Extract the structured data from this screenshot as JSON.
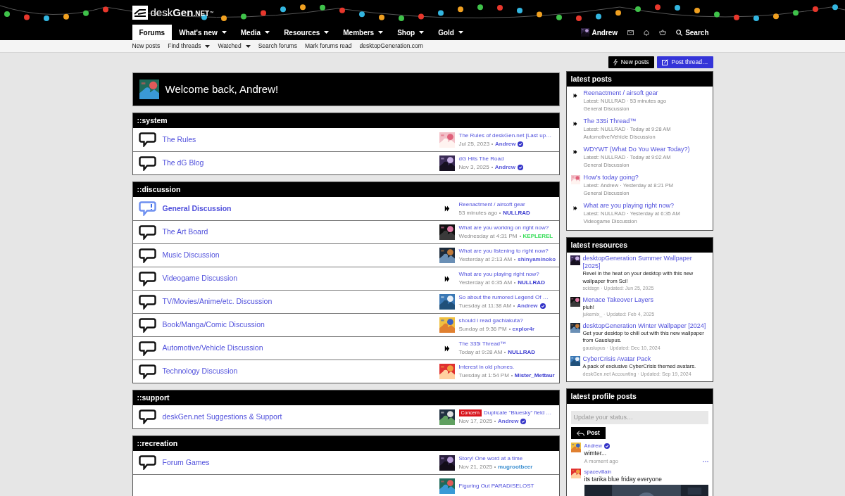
{
  "logo": {
    "name": "desk",
    "bold": "Gen",
    "suffix": ".NET",
    "mark": "™"
  },
  "nav": [
    {
      "label": "Forums",
      "selected": true,
      "dropdown": false
    },
    {
      "label": "What's new",
      "selected": false,
      "dropdown": true
    },
    {
      "label": "Media",
      "selected": false,
      "dropdown": true
    },
    {
      "label": "Resources",
      "selected": false,
      "dropdown": true
    },
    {
      "label": "Members",
      "selected": false,
      "dropdown": true
    },
    {
      "label": "Shop",
      "selected": false,
      "dropdown": true
    },
    {
      "label": "Gold",
      "selected": false,
      "dropdown": true
    }
  ],
  "user": {
    "name": "Andrew"
  },
  "header_search": "Search",
  "subnav": [
    {
      "label": "New posts",
      "dropdown": false
    },
    {
      "label": "Find threads",
      "dropdown": true
    },
    {
      "label": "Watched",
      "dropdown": true
    },
    {
      "label": "Search forums",
      "dropdown": false
    },
    {
      "label": "Mark forums read",
      "dropdown": false
    },
    {
      "label": "desktopGeneration.com",
      "dropdown": false
    }
  ],
  "actions": [
    {
      "kind": "new",
      "label": "New posts"
    },
    {
      "kind": "post",
      "label": "Post thread…"
    }
  ],
  "welcome": "Welcome back, Andrew!",
  "sections": [
    {
      "title": "::system",
      "forums": [
        {
          "name": "The Rules",
          "unread": false,
          "last_post": {
            "title": "The Rules of deskGen.net [Last up…",
            "time": "Jul 25, 2023",
            "author": "Andrew",
            "verified": true,
            "color": "#5c5cdb"
          }
        },
        {
          "name": "The dG Blog",
          "unread": false,
          "last_post": {
            "title": "dG Hits The Road",
            "time": "Nov 3, 2025",
            "author": "Andrew",
            "verified": true,
            "color": "#5c5cdb"
          }
        }
      ]
    },
    {
      "title": "::discussion",
      "forums": [
        {
          "name": "General Discussion",
          "unread": true,
          "last_post": {
            "avatar": {
              "kind": "logo"
            },
            "title": "Reenactment / airsoft gear",
            "time": "53 minutes ago",
            "author": "NULLRAD",
            "verified": false,
            "color": "#3b3bd0"
          }
        },
        {
          "name": "The Art Board",
          "unread": false,
          "last_post": {
            "title": "What are you working on right now?",
            "time": "Wednesday at 4:31 PM",
            "author": "KEPLEREL",
            "verified": false,
            "color": "#33dd55"
          }
        },
        {
          "name": "Music Discussion",
          "unread": false,
          "last_post": {
            "title": "What are you listening to right now?",
            "time": "Yesterday at 2:13 AM",
            "author": "shinyaminoko",
            "verified": false,
            "color": "#5c5cdb"
          }
        },
        {
          "name": "Videogame Discussion",
          "unread": false,
          "last_post": {
            "avatar": {
              "kind": "logo"
            },
            "title": "What are you playing right now?",
            "time": "Yesterday at 6:35 AM",
            "author": "NULLRAD",
            "verified": false,
            "color": "#3b3bd0"
          }
        },
        {
          "name": "TV/Movies/Anime/etc. Discussion",
          "unread": false,
          "last_post": {
            "title": "So about the rumored Legend Of …",
            "time": "Tuesday at 11:38 AM",
            "author": "Andrew",
            "verified": true,
            "color": "#5c5cdb"
          }
        },
        {
          "name": "Book/Manga/Comic Discussion",
          "unread": false,
          "last_post": {
            "title": "should i read gachiakuta?",
            "time": "Sunday at 9:36 PM",
            "author": "explor4r",
            "verified": false,
            "color": "#5c5cdb"
          }
        },
        {
          "name": "Automotive/Vehicle Discussion",
          "unread": false,
          "last_post": {
            "avatar": {
              "kind": "logo"
            },
            "title": "The 335i Thread™",
            "time": "Today at 9:28 AM",
            "author": "NULLRAD",
            "verified": false,
            "color": "#3b3bd0"
          }
        },
        {
          "name": "Technology Discussion",
          "unread": false,
          "last_post": {
            "title": "Interest in old phones.",
            "time": "Tuesday at 1:54 PM",
            "author": "Mister_Mettaur",
            "verified": false,
            "color": "#3b3bd0"
          }
        }
      ]
    },
    {
      "title": "::support",
      "forums": [
        {
          "name": "deskGen.net Suggestions & Support",
          "unread": false,
          "last_post": {
            "prefix": "Concern",
            "title": "Duplicate \"Bluesky\" field …",
            "time": "Nov 17, 2025",
            "author": "Andrew",
            "verified": true,
            "color": "#5c5cdb"
          }
        }
      ]
    },
    {
      "title": "::recreation",
      "forums": [
        {
          "name": "Forum Games",
          "unread": false,
          "last_post": {
            "title": "Story! One word at a time",
            "time": "Nov 21, 2025",
            "author": "mugrootbeer",
            "verified": false,
            "color": "#3b8fd0"
          }
        },
        {
          "last_post": {
            "title": "Figuring Out PARADISELOST"
          }
        }
      ]
    }
  ],
  "latest_posts": {
    "title": "latest posts",
    "items": [
      {
        "avatar": {
          "kind": "logo"
        },
        "title": "Reenactment / airsoft gear",
        "meta": "Latest: NULLRAD · 53 minutes ago",
        "forum": "General Discussion"
      },
      {
        "avatar": {
          "kind": "logo"
        },
        "title": "The 335i Thread™",
        "meta": "Latest: NULLRAD · Today at 9:28 AM",
        "forum": "Automotive/Vehicle Discussion"
      },
      {
        "avatar": {
          "kind": "logo"
        },
        "title": "WDYWT (What Do You Wear Today?)",
        "meta": "Latest: NULLRAD · Today at 9:02 AM",
        "forum": "General Discussion"
      },
      {
        "title": "How's today going?",
        "meta": "Latest: Andrew · Yesterday at 8:21 PM",
        "forum": "General Discussion"
      },
      {
        "avatar": {
          "kind": "logo"
        },
        "title": "What are you playing right now?",
        "meta": "Latest: NULLRAD · Yesterday at 6:35 AM",
        "forum": "Videogame Discussion"
      }
    ]
  },
  "latest_resources": {
    "title": "latest resources",
    "items": [
      {
        "title": "desktopGeneration Summer Wallpaper [2025]",
        "description": "Revel in the heat on your desktop with this new wallpaper from Sci!",
        "meta": "scidsgn · Updated: Jun 25, 2025"
      },
      {
        "title": "Menace Takeover Layers",
        "description": "pluh!",
        "meta": "jukemix_ · Updated: Feb 4, 2025"
      },
      {
        "title": "desktopGeneration Winter Wallpaper [2024]",
        "description": "Get your desktop to chill out with this new wallpaper from Gauslupus.",
        "meta": "gauslupus · Updated: Dec 10, 2024"
      },
      {
        "title": "CyberCrisis Avatar Pack",
        "description": "A pack of exclusive CyberCrisis themed avatars.",
        "meta": "deskGen.net Accounting · Updated: Sep 19, 2024"
      }
    ]
  },
  "profile_posts": {
    "title": "latest profile posts",
    "placeholder": "Update your status…",
    "button": "Post",
    "posts": [
      {
        "author": "Andrew",
        "verified": true,
        "text": "wimter...",
        "time": "A moment ago"
      },
      {
        "author": "spacevillain",
        "verified": false,
        "text": "its tarika blue friday everyone"
      }
    ]
  }
}
